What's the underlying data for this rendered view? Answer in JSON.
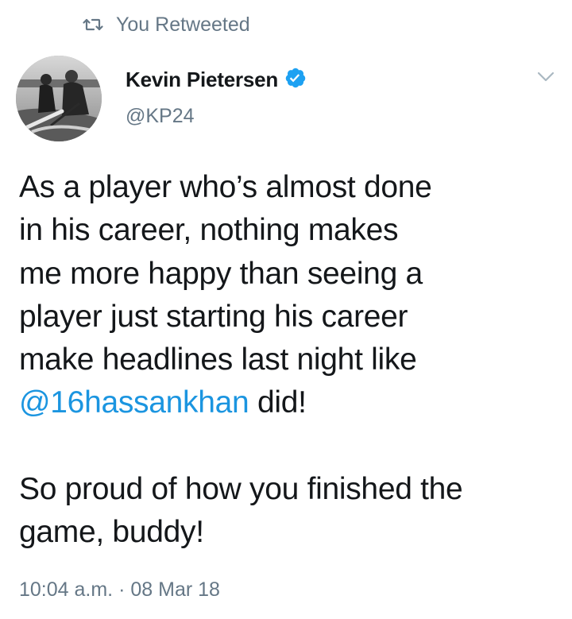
{
  "retweet_banner": {
    "icon": "retweet-icon",
    "label": "You Retweeted"
  },
  "author": {
    "name": "Kevin Pietersen",
    "handle": "@KP24",
    "verified": true,
    "verified_icon": "verified-badge-icon",
    "verified_color": "#1da1f2"
  },
  "menu_icon": "chevron-down-icon",
  "tweet": {
    "lines": [
      "As a player who’s almost done",
      "in his career, nothing makes",
      "me more happy than seeing a",
      "player just starting his career",
      "make headlines last night like"
    ],
    "mention": "@16hassankhan",
    "mention_suffix": " did!",
    "second_paragraph_lines": [
      "So proud of how you finished the",
      "game, buddy!"
    ]
  },
  "meta": {
    "time": "10:04 a.m.",
    "separator": " · ",
    "date": "08 Mar 18"
  },
  "colors": {
    "link": "#1b95e0",
    "secondary_text": "#657786",
    "primary_text": "#14171a"
  }
}
